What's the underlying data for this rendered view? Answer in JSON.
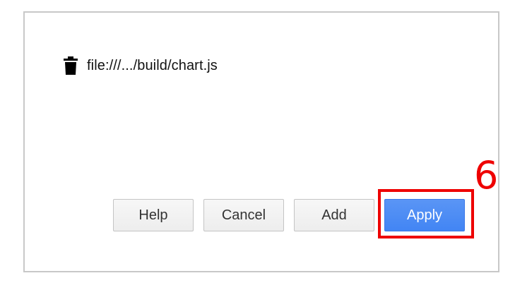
{
  "dialog": {
    "file_path": "file:///.../build/chart.js",
    "file_icon": "trash-icon"
  },
  "buttons": {
    "help_label": "Help",
    "cancel_label": "Cancel",
    "add_label": "Add",
    "apply_label": "Apply"
  },
  "annotation": {
    "number": "6",
    "color": "#ee0000"
  },
  "colors": {
    "apply_accent": "#4285f4",
    "dialog_border": "#c8c8c8"
  }
}
